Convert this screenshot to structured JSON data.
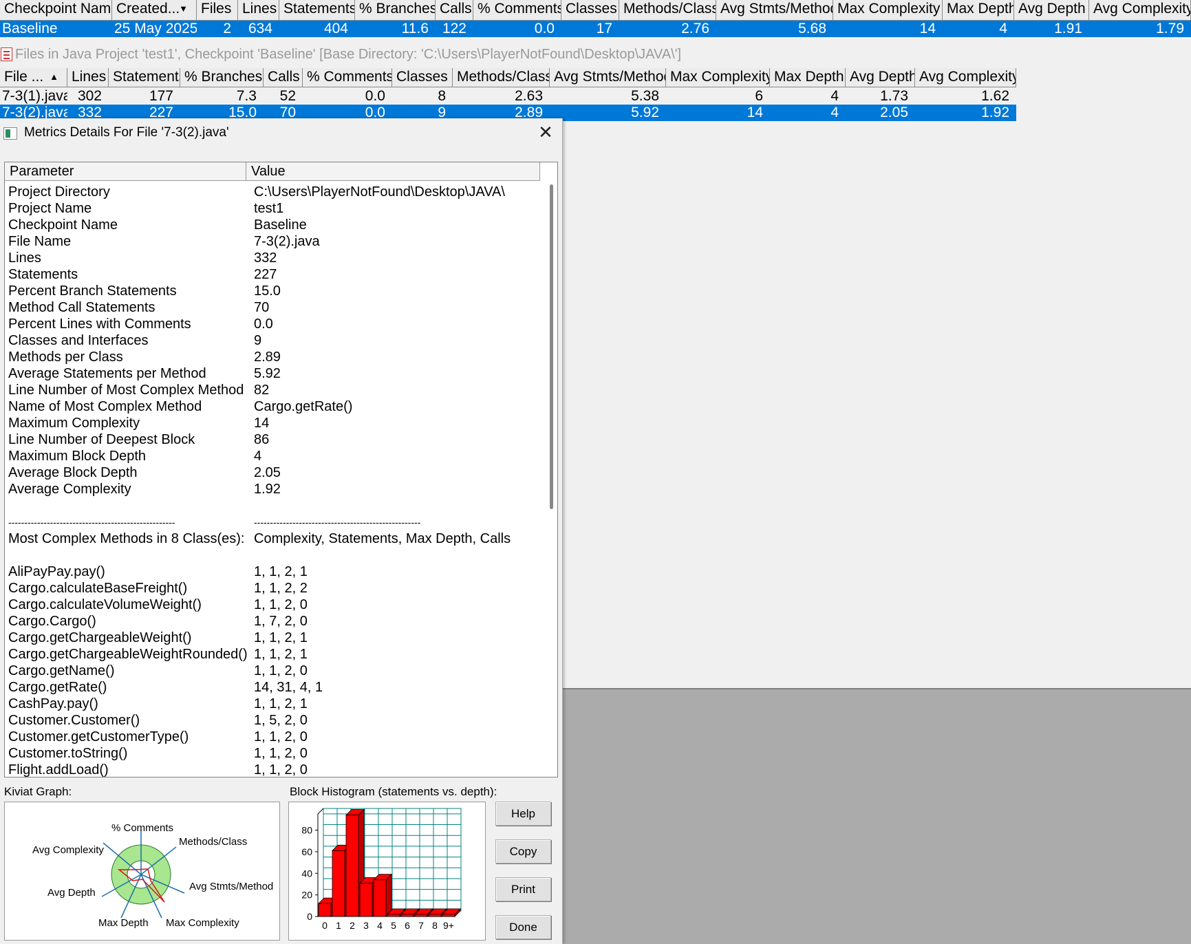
{
  "checkpoints": {
    "headers": [
      "Checkpoint Name",
      "Created...",
      "Files",
      "Lines",
      "Statements",
      "% Branches",
      "Calls",
      "% Comments",
      "Classes",
      "Methods/Class",
      "Avg Stmts/Method",
      "Max Complexity",
      "Max Depth",
      "Avg Depth",
      "Avg Complexity"
    ],
    "sort_icon": "sort-desc-icon",
    "rows": [
      [
        "Baseline",
        "25 May 2025",
        "2",
        "634",
        "404",
        "11.6",
        "122",
        "0.0",
        "17",
        "2.76",
        "5.68",
        "14",
        "4",
        "1.91",
        "1.79"
      ]
    ]
  },
  "files_panel": {
    "title": "Files in Java Project 'test1', Checkpoint 'Baseline'  [Base Directory: 'C:\\Users\\PlayerNotFound\\Desktop\\JAVA\\']",
    "headers": [
      "File ...",
      "Lines",
      "Statements",
      "% Branches",
      "Calls",
      "% Comments",
      "Classes",
      "Methods/Class",
      "Avg Stmts/Method",
      "Max Complexity",
      "Max Depth",
      "Avg Depth",
      "Avg Complexity"
    ],
    "sort_icon": "sort-asc-icon",
    "rows": [
      [
        "7-3(1).java",
        "302",
        "177",
        "7.3",
        "52",
        "0.0",
        "8",
        "2.63",
        "5.38",
        "6",
        "4",
        "1.73",
        "1.62"
      ],
      [
        "7-3(2).java",
        "332",
        "227",
        "15.0",
        "70",
        "0.0",
        "9",
        "2.89",
        "5.92",
        "14",
        "4",
        "2.05",
        "1.92"
      ]
    ]
  },
  "dialog": {
    "title": "Metrics Details For File '7-3(2).java'",
    "close_icon": "close-icon",
    "param_header": "Parameter",
    "value_header": "Value",
    "rows": [
      [
        "Project Directory",
        "C:\\Users\\PlayerNotFound\\Desktop\\JAVA\\"
      ],
      [
        "Project Name",
        "test1"
      ],
      [
        "Checkpoint Name",
        "Baseline"
      ],
      [
        "File Name",
        "7-3(2).java"
      ],
      [
        "Lines",
        "332"
      ],
      [
        "Statements",
        "227"
      ],
      [
        "Percent Branch Statements",
        "15.0"
      ],
      [
        "Method Call Statements",
        "70"
      ],
      [
        "Percent Lines with Comments",
        "0.0"
      ],
      [
        "Classes and Interfaces",
        "9"
      ],
      [
        "Methods per Class",
        "2.89"
      ],
      [
        "Average Statements per Method",
        "5.92"
      ],
      [
        "Line Number of Most Complex Method",
        "82"
      ],
      [
        "Name of Most Complex Method",
        "Cargo.getRate()"
      ],
      [
        "Maximum Complexity",
        "14"
      ],
      [
        "Line Number of Deepest Block",
        "86"
      ],
      [
        "Maximum Block Depth",
        "4"
      ],
      [
        "Average Block Depth",
        "2.05"
      ],
      [
        "Average Complexity",
        "1.92"
      ],
      [
        "",
        ""
      ],
      [
        "----------------------------------------------------",
        "----------------------------------------------------"
      ],
      [
        "Most Complex Methods in 8 Class(es):",
        "Complexity, Statements, Max Depth, Calls"
      ],
      [
        "",
        ""
      ],
      [
        "AliPayPay.pay()",
        "1, 1, 2, 1"
      ],
      [
        "Cargo.calculateBaseFreight()",
        "1, 1, 2, 2"
      ],
      [
        "Cargo.calculateVolumeWeight()",
        "1, 1, 2, 0"
      ],
      [
        "Cargo.Cargo()",
        "1, 7, 2, 0"
      ],
      [
        "Cargo.getChargeableWeight()",
        "1, 1, 2, 1"
      ],
      [
        "Cargo.getChargeableWeightRounded()",
        "1, 1, 2, 1"
      ],
      [
        "Cargo.getName()",
        "1, 1, 2, 0"
      ],
      [
        "Cargo.getRate()",
        "14, 31, 4, 1"
      ],
      [
        "CashPay.pay()",
        "1, 1, 2, 1"
      ],
      [
        "Customer.Customer()",
        "1, 5, 2, 0"
      ],
      [
        "Customer.getCustomerType()",
        "1, 1, 2, 0"
      ],
      [
        "Customer.toString()",
        "1, 1, 2, 0"
      ],
      [
        "Flight.addLoad()",
        "1, 1, 2, 0"
      ]
    ],
    "kiviat_label": "Kiviat Graph:",
    "kiviat_axes": [
      "% Comments",
      "Methods/Class",
      "Avg Stmts/Method",
      "Max Complexity",
      "Max Depth",
      "Avg Depth",
      "Avg Complexity"
    ],
    "histogram_label": "Block Histogram (statements vs. depth):",
    "buttons": {
      "help": "Help",
      "copy": "Copy",
      "print": "Print",
      "done": "Done"
    }
  },
  "chart_data": {
    "type": "bar",
    "title": "Block Histogram (statements vs. depth):",
    "categories": [
      "0",
      "1",
      "2",
      "3",
      "4",
      "5",
      "6",
      "7",
      "8",
      "9+"
    ],
    "values": [
      12,
      61,
      94,
      31,
      34,
      2,
      2,
      2,
      2,
      2
    ],
    "ylim": [
      0,
      95
    ],
    "yticks": [
      "0",
      "20",
      "40",
      "60",
      "80"
    ],
    "bar_color": "#ff0000",
    "grid_color": "#008080",
    "grid": true
  },
  "colors": {
    "selection": "#0078d7",
    "gray_area": "#ababab"
  }
}
